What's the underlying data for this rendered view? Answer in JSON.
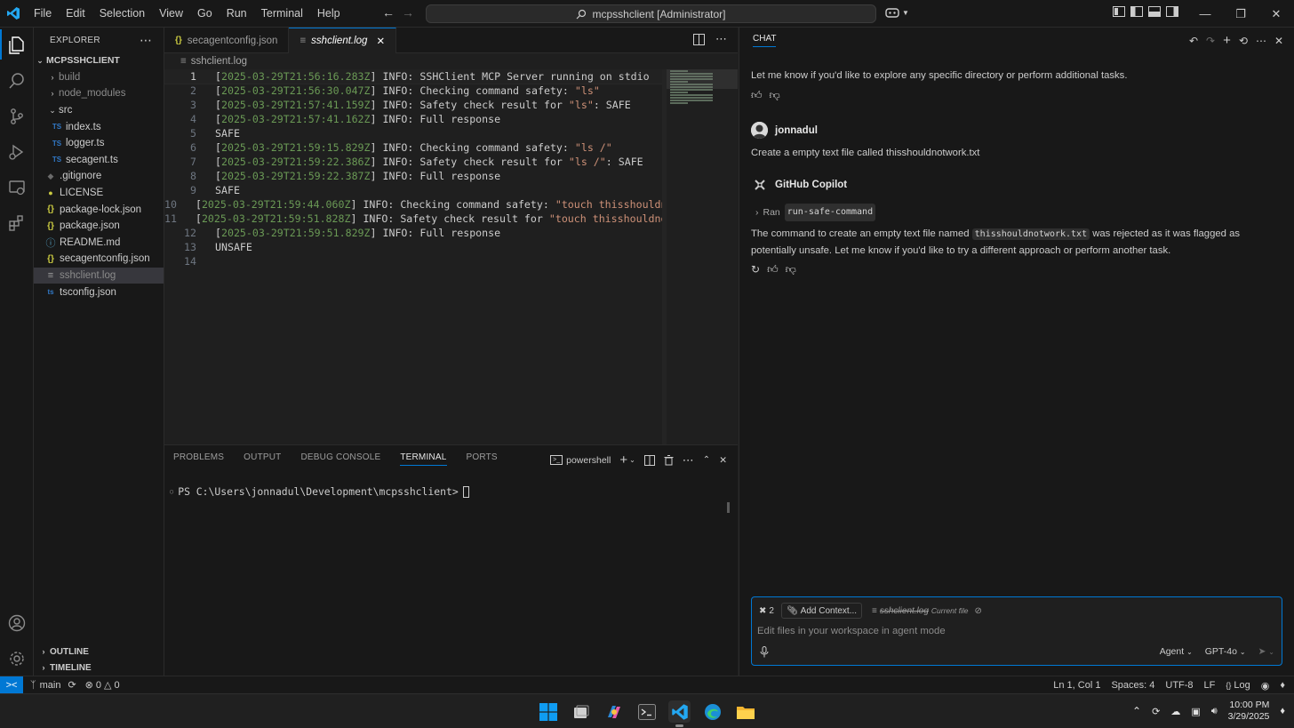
{
  "titlebar": {
    "menu": [
      "File",
      "Edit",
      "Selection",
      "View",
      "Go",
      "Run",
      "Terminal",
      "Help"
    ],
    "search_text": "mcpsshclient [Administrator]"
  },
  "explorer": {
    "header": "EXPLORER",
    "root": "MCPSSHCLIENT",
    "items": [
      {
        "label": "build",
        "type": "folder"
      },
      {
        "label": "node_modules",
        "type": "folder"
      },
      {
        "label": "src",
        "type": "folder-open"
      },
      {
        "label": "index.ts",
        "type": "ts"
      },
      {
        "label": "logger.ts",
        "type": "ts"
      },
      {
        "label": "secagent.ts",
        "type": "ts"
      },
      {
        "label": ".gitignore",
        "type": "gitignore"
      },
      {
        "label": "LICENSE",
        "type": "license"
      },
      {
        "label": "package-lock.json",
        "type": "json"
      },
      {
        "label": "package.json",
        "type": "json"
      },
      {
        "label": "README.md",
        "type": "md"
      },
      {
        "label": "secagentconfig.json",
        "type": "json"
      },
      {
        "label": "sshclient.log",
        "type": "log"
      },
      {
        "label": "tsconfig.json",
        "type": "tsconfig"
      }
    ],
    "outline": "OUTLINE",
    "timeline": "TIMELINE"
  },
  "editor": {
    "tabs": [
      {
        "label": "secagentconfig.json",
        "icon": "json-icon"
      },
      {
        "label": "sshclient.log",
        "icon": "log-icon"
      }
    ],
    "breadcrumb": "sshclient.log",
    "lines": [
      {
        "n": "1",
        "ts": "2025-03-29T21:56:16.283Z",
        "msg": " INFO: SSHClient MCP Server running on stdio",
        "q": ""
      },
      {
        "n": "2",
        "ts": "2025-03-29T21:56:30.047Z",
        "msg": " INFO: Checking command safety: ",
        "q": "\"ls\""
      },
      {
        "n": "3",
        "ts": "2025-03-29T21:57:41.159Z",
        "msg": " INFO: Safety check result for ",
        "q": "\"ls\"",
        "tail": ": SAFE"
      },
      {
        "n": "4",
        "ts": "2025-03-29T21:57:41.162Z",
        "msg": " INFO: Full response",
        "q": ""
      },
      {
        "n": "5",
        "plain": "SAFE"
      },
      {
        "n": "6",
        "ts": "2025-03-29T21:59:15.829Z",
        "msg": " INFO: Checking command safety: ",
        "q": "\"ls /\""
      },
      {
        "n": "7",
        "ts": "2025-03-29T21:59:22.386Z",
        "msg": " INFO: Safety check result for ",
        "q": "\"ls /\"",
        "tail": ": SAFE"
      },
      {
        "n": "8",
        "ts": "2025-03-29T21:59:22.387Z",
        "msg": " INFO: Full response",
        "q": ""
      },
      {
        "n": "9",
        "plain": "SAFE"
      },
      {
        "n": "10",
        "ts": "2025-03-29T21:59:44.060Z",
        "msg": " INFO: Checking command safety: ",
        "q": "\"touch thisshouldnot"
      },
      {
        "n": "11",
        "ts": "2025-03-29T21:59:51.828Z",
        "msg": " INFO: Safety check result for ",
        "q": "\"touch thisshouldnotw"
      },
      {
        "n": "12",
        "ts": "2025-03-29T21:59:51.829Z",
        "msg": " INFO: Full response",
        "q": ""
      },
      {
        "n": "13",
        "plain": "UNSAFE"
      },
      {
        "n": "14",
        "plain": ""
      }
    ]
  },
  "panel": {
    "tabs": [
      "PROBLEMS",
      "OUTPUT",
      "DEBUG CONSOLE",
      "TERMINAL",
      "PORTS"
    ],
    "shell": "powershell",
    "prompt": "PS C:\\Users\\jonnadul\\Development\\mcpsshclient>"
  },
  "chat": {
    "header": "CHAT",
    "prev_response": "Let me know if you'd like to explore any specific directory or perform additional tasks.",
    "user_name": "jonnadul",
    "user_message": "Create a empty text file called thisshouldnotwork.txt",
    "bot_name": "GitHub Copilot",
    "ran_label": "Ran",
    "ran_tool": "run-safe-command",
    "response_p1": "The command to create an empty text file named ",
    "response_code": "thisshouldnotwork.txt",
    "response_p2": " was rejected as it was flagged as potentially unsafe. Let me know if you'd like to try a different approach or perform another task.",
    "input": {
      "tools_count": "2",
      "add_context": "Add Context...",
      "file_chip": "sshclient.log",
      "file_chip_note": "Current file",
      "placeholder": "Edit files in your workspace in agent mode",
      "mode": "Agent",
      "model": "GPT-4o"
    }
  },
  "statusbar": {
    "branch": "main",
    "errors": "0",
    "warnings": "0",
    "position": "Ln 1, Col 1",
    "spaces": "Spaces: 4",
    "encoding": "UTF-8",
    "eol": "LF",
    "language": "Log"
  },
  "taskbar": {
    "time": "10:00 PM",
    "date": "3/29/2025"
  },
  "colors": {
    "accent": "#0078d4",
    "timestamp": "#6a9955",
    "string": "#ce9178"
  }
}
